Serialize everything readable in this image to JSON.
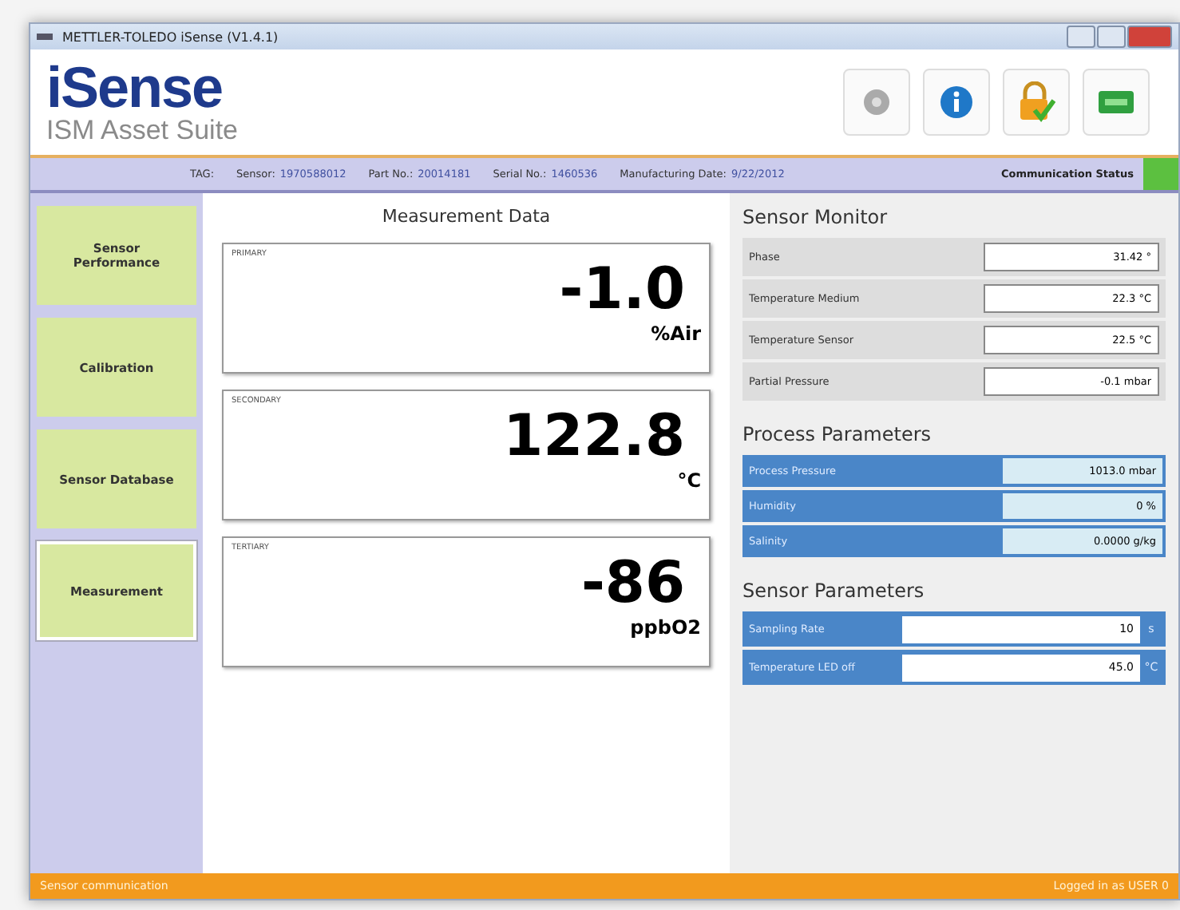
{
  "window": {
    "title": "METTLER-TOLEDO iSense (V1.4.1)"
  },
  "header": {
    "logo": "iSense",
    "subtitle": "ISM Asset Suite"
  },
  "info_bar": {
    "fields": [
      {
        "label": "TAG:"
      },
      {
        "label": "Sensor:",
        "value": "1970588012"
      },
      {
        "label": "Part No.:",
        "value": "20014181"
      },
      {
        "label": "Serial No.:",
        "value": "1460536"
      },
      {
        "label": "Manufacturing Date:",
        "value": "9/22/2012"
      }
    ],
    "communication_status": {
      "label": "Communication Status",
      "ok": true
    }
  },
  "sidebar": {
    "items": [
      {
        "label": "Sensor Performance",
        "selected": false
      },
      {
        "label": "Calibration",
        "selected": false
      },
      {
        "label": "Sensor Database",
        "selected": false
      },
      {
        "label": "Measurement",
        "selected": true
      }
    ]
  },
  "measurement": {
    "title": "Measurement Data",
    "readings": [
      {
        "label": "PRIMARY",
        "value": "-1.0",
        "unit": "%Air"
      },
      {
        "label": "SECONDARY",
        "value": "122.8",
        "unit": "°C"
      },
      {
        "label": "TERTIARY",
        "value": "-86",
        "unit": "ppbO2"
      }
    ]
  },
  "sensor_monitor": {
    "title": "Sensor Monitor",
    "rows": [
      {
        "label": "Phase",
        "value": "31.42 °"
      },
      {
        "label": "Temperature Medium",
        "value": "22.3 °C"
      },
      {
        "label": "Temperature Sensor",
        "value": "22.5 °C"
      },
      {
        "label": "Partial Pressure",
        "value": "-0.1 mbar"
      }
    ]
  },
  "process_parameters": {
    "title": "Process Parameters",
    "rows": [
      {
        "label": "Process Pressure",
        "value": "1013.0 mbar"
      },
      {
        "label": "Humidity",
        "value": "0 %"
      },
      {
        "label": "Salinity",
        "value": "0.0000 g/kg"
      }
    ]
  },
  "sensor_parameters": {
    "title": "Sensor Parameters",
    "rows": [
      {
        "label": "Sampling Rate",
        "value": "10",
        "unit": "s"
      },
      {
        "label": "Temperature LED off",
        "value": "45.0",
        "unit": "°C"
      }
    ]
  },
  "status_bar": {
    "left": "Sensor communication",
    "right": "Logged in as USER 0"
  }
}
